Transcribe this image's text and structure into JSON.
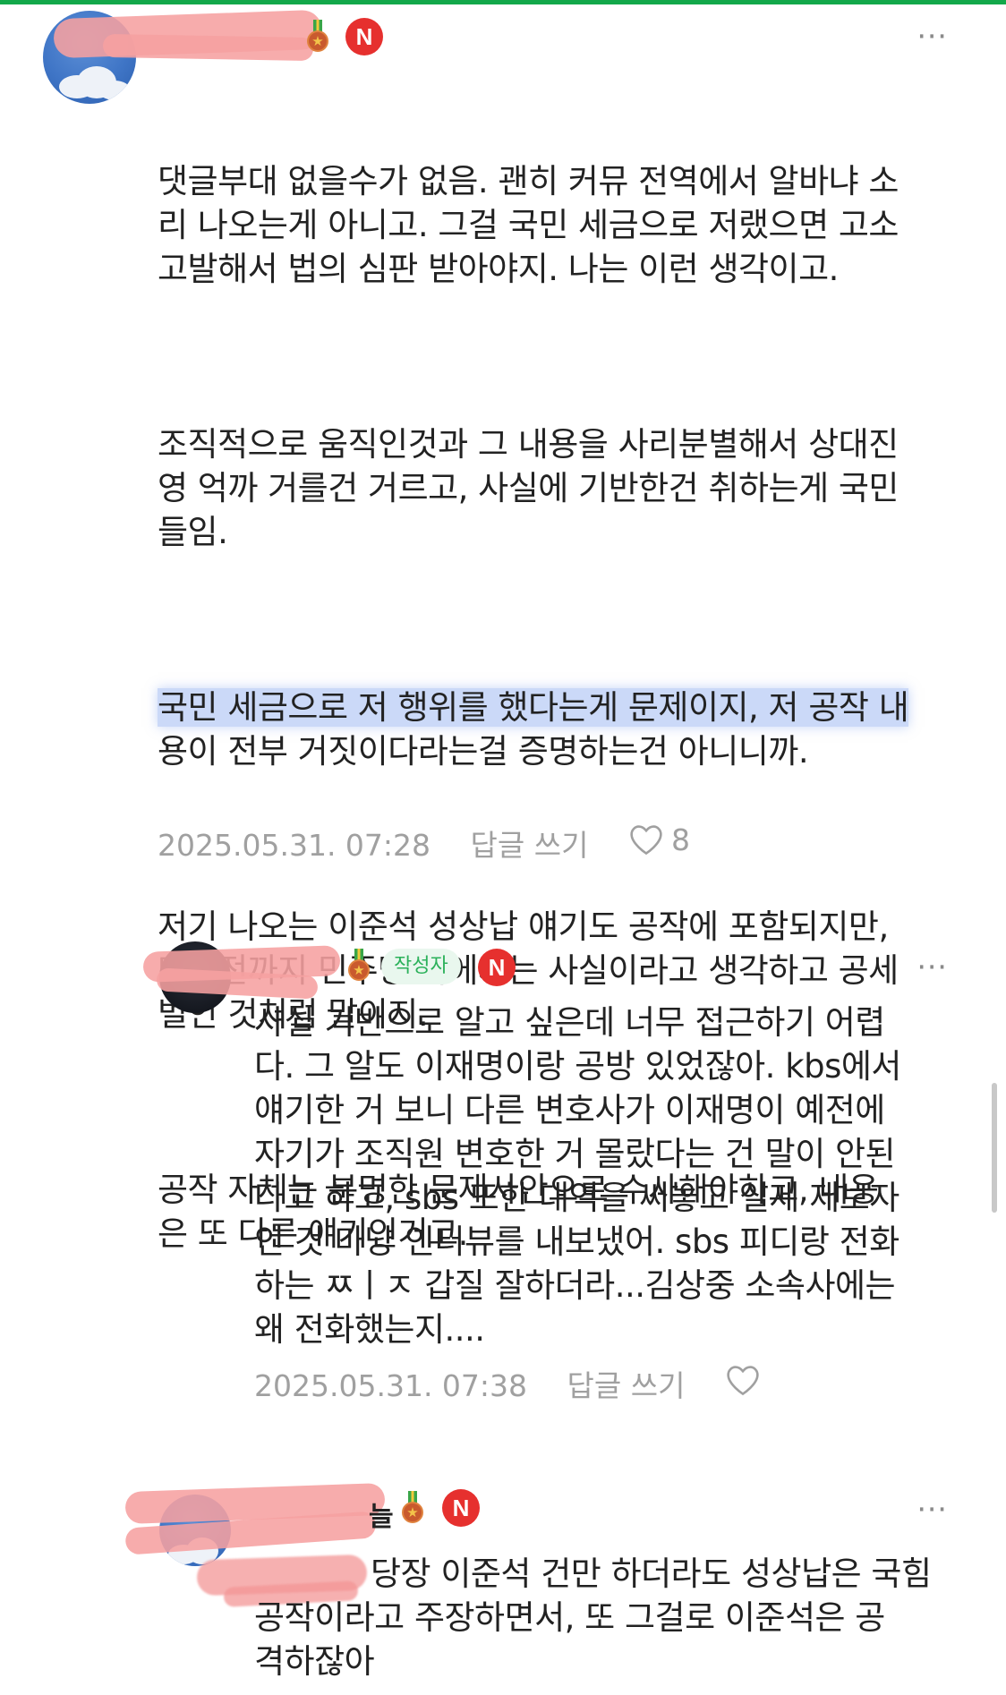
{
  "comments": [
    {
      "username": "",
      "badge": "N",
      "paragraphs": [
        "댓글부대 없을수가 없음. 괜히 커뮤 전역에서 알바냐 소\n리 나오는게 아니고. 그걸 국민 세금으로 저랬으면 고소\n고발해서 법의 심판 받아야지. 나는 이런 생각이고.",
        "조직적으로 움직인것과 그 내용을 사리분별해서 상대진\n영 억까 거를건 거르고, 사실에 기반한건 취하는게 국민\n들임."
      ],
      "highlighted_line1": "국민 세금으로 저 행위를 했다는게 문제이지, 저 공작 내",
      "highlighted_line2": "용이 전부 거짓이다라는걸 증명하는건 아니니까.",
      "paragraphs_after": [
        "저기 나오는 이준석 성상납 얘기도 공작에 포함되지만,\n며칠전까지 민주당 측에서는 사실이라고 생각하고 공세\n벌인 것처럼 말이지.",
        "공작 자체는 분명한 문제사안으로 수사해야하고, 내용\n은 또 다른 얘기인거고."
      ],
      "date": "2025.05.31. 07:28",
      "reply_label": "답글 쓰기",
      "likes": "8"
    },
    {
      "username": "",
      "author_tag": "작성자",
      "badge": "N",
      "text": "사실 기반으로 알고 싶은데 너무 접근하기 어렵\n다. 그 알도 이재명이랑 공방 있었잖아. kbs에서\n얘기한 거 보니 다른 변호사가 이재명이 예전에\n자기가 조직원 변호한 거 몰랐다는 건 말이 안된\n다고 하고, sbs 또한 대역을 써놓고 실제 제보자\n인 것 마냥 인터뷰를 내보냈어. sbs 피디랑 전화\n하는 ㅉㅣㅈ 갑질 잘하더라...김상중 소속사에는\n왜 전화했는지....",
      "date": "2025.05.31. 07:38",
      "reply_label": "답글 쓰기",
      "likes": ""
    },
    {
      "username": "늘",
      "badge": "N",
      "text": "당장 이준석 건만 하더라도 성상납은 국힘\n공작이라고 주장하면서, 또 그걸로 이준석은 공\n격하잖아"
    }
  ],
  "more_icon": "⋯",
  "colors": {
    "accent_green": "#13a84a",
    "badge_red": "#e6302e",
    "highlight": "#8caaf0"
  }
}
